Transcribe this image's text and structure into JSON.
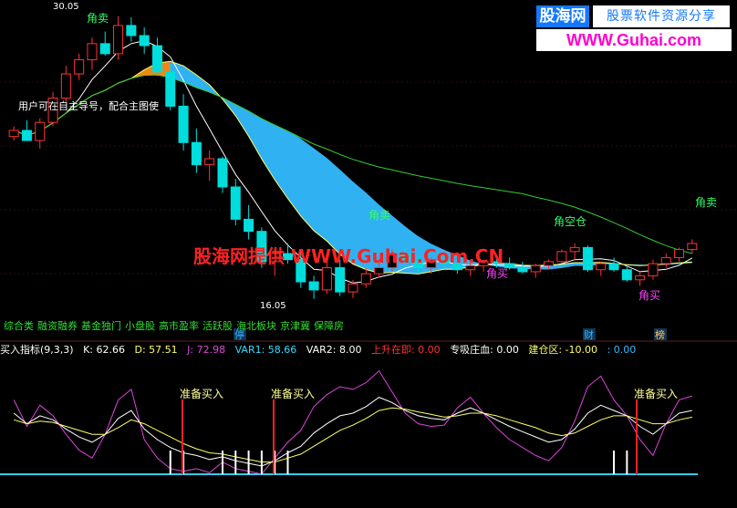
{
  "watermark": {
    "logo_text": "股海网",
    "tagline": "股票软件资源分享",
    "url": "WWW.Guhai.com",
    "center_text": "股海网提供 WWW.Guhai.Com.CN"
  },
  "tag_row": [
    "综合类",
    "融资融券",
    "基金独门",
    "小盘股",
    "高市盈率",
    "活跃股",
    "海北板块",
    "京津冀",
    "保障房"
  ],
  "indicator_header": {
    "name": "买入指标(9,3,3)",
    "k": "K: 62.66",
    "d": "D: 57.51",
    "j": "J: 72.98",
    "var1": "VAR1: 58.66",
    "var2": "VAR2: 8.00",
    "rise": "上升在即: 0.00",
    "zhuang": "专吸庄血: 0.00",
    "jiancang": "建仓区: -10.00",
    "tail": ": 0.00"
  },
  "colors": {
    "background": "#000000",
    "candle_up": "#ff3333",
    "candle_down": "#00dddd",
    "ribbon_orange": "#ff8c1a",
    "ribbon_blue": "#33bbff",
    "k_line": "#ffffff",
    "d_line": "#ffff66",
    "j_line": "#dd44dd",
    "baseline": "#33ccff",
    "signal": "#ff2222"
  },
  "chart_data": {
    "type": "candlestick",
    "price_high_label": "30.05",
    "price_low_label": "16.05",
    "annotations": {
      "sell_label": "角卖",
      "buy_label": "角买",
      "rise_label": "角空仓",
      "prepare_buy": "准备买入",
      "stop": "停",
      "finance": "财",
      "bank": "榜",
      "mid_text": "用户可在自主导号，配合主图使"
    },
    "candles": [
      [
        24.1,
        24.6,
        23.9,
        24.4
      ],
      [
        24.4,
        24.9,
        24.0,
        23.9
      ],
      [
        23.9,
        25.0,
        23.5,
        24.8
      ],
      [
        24.8,
        26.3,
        24.6,
        26.0
      ],
      [
        26.0,
        27.6,
        25.8,
        27.2
      ],
      [
        27.2,
        28.2,
        26.9,
        27.9
      ],
      [
        27.9,
        29.0,
        27.4,
        28.7
      ],
      [
        28.7,
        29.3,
        28.1,
        28.2
      ],
      [
        28.2,
        30.05,
        27.9,
        29.6
      ],
      [
        29.6,
        30.0,
        28.8,
        29.1
      ],
      [
        29.1,
        29.5,
        28.2,
        28.6
      ],
      [
        28.6,
        29.0,
        27.1,
        27.3
      ],
      [
        27.3,
        27.7,
        25.4,
        25.6
      ],
      [
        25.6,
        26.2,
        23.4,
        23.8
      ],
      [
        23.8,
        24.5,
        22.3,
        22.7
      ],
      [
        22.7,
        23.4,
        21.9,
        23.0
      ],
      [
        23.0,
        23.1,
        21.3,
        21.6
      ],
      [
        21.6,
        22.0,
        19.7,
        20.0
      ],
      [
        20.0,
        20.7,
        19.0,
        19.4
      ],
      [
        19.4,
        19.6,
        17.6,
        17.9
      ],
      [
        17.9,
        18.5,
        17.2,
        18.3
      ],
      [
        18.3,
        18.8,
        17.8,
        18.0
      ],
      [
        18.0,
        18.4,
        16.6,
        16.9
      ],
      [
        16.9,
        17.2,
        16.05,
        16.5
      ],
      [
        16.5,
        17.9,
        16.3,
        17.6
      ],
      [
        17.6,
        18.0,
        16.2,
        16.4
      ],
      [
        16.4,
        17.0,
        16.1,
        16.8
      ],
      [
        16.8,
        17.6,
        16.6,
        17.3
      ],
      [
        17.3,
        18.0,
        17.1,
        17.6
      ],
      [
        17.6,
        18.5,
        17.4,
        18.3
      ],
      [
        18.3,
        18.6,
        17.8,
        17.9
      ],
      [
        17.9,
        18.2,
        17.4,
        17.6
      ],
      [
        17.6,
        18.1,
        17.3,
        18.0
      ],
      [
        18.0,
        18.3,
        17.6,
        17.8
      ],
      [
        17.8,
        18.0,
        17.3,
        17.5
      ],
      [
        17.5,
        17.9,
        17.2,
        17.7
      ],
      [
        17.7,
        18.0,
        17.4,
        17.9
      ],
      [
        17.9,
        18.2,
        17.6,
        17.8
      ],
      [
        17.8,
        18.1,
        17.5,
        17.6
      ],
      [
        17.6,
        17.9,
        17.3,
        17.4
      ],
      [
        17.4,
        17.8,
        17.1,
        17.7
      ],
      [
        17.7,
        18.0,
        17.5,
        17.9
      ],
      [
        17.9,
        18.5,
        17.8,
        18.4
      ],
      [
        18.4,
        18.8,
        18.0,
        18.6
      ],
      [
        18.6,
        18.7,
        17.4,
        17.5
      ],
      [
        17.5,
        17.9,
        17.2,
        17.8
      ],
      [
        17.8,
        18.1,
        17.4,
        17.5
      ],
      [
        17.5,
        17.7,
        16.9,
        17.0
      ],
      [
        17.0,
        17.4,
        16.7,
        17.2
      ],
      [
        17.2,
        18.0,
        17.0,
        17.8
      ],
      [
        17.8,
        18.3,
        17.6,
        18.1
      ],
      [
        18.1,
        18.6,
        17.9,
        18.5
      ],
      [
        18.5,
        19.0,
        18.3,
        18.8
      ]
    ],
    "k_values": [
      60,
      52,
      58,
      55,
      48,
      42,
      38,
      44,
      56,
      62,
      48,
      40,
      34,
      30,
      28,
      25,
      27,
      24,
      22,
      20,
      24,
      30,
      35,
      45,
      52,
      58,
      60,
      65,
      72,
      68,
      62,
      58,
      56,
      55,
      60,
      64,
      60,
      55,
      50,
      46,
      42,
      38,
      40,
      48,
      60,
      66,
      62,
      58,
      50,
      44,
      52,
      60,
      62
    ],
    "d_values": [
      55,
      52,
      54,
      53,
      50,
      47,
      44,
      44,
      49,
      55,
      52,
      47,
      42,
      37,
      33,
      30,
      29,
      27,
      25,
      23,
      23,
      26,
      29,
      35,
      41,
      47,
      51,
      56,
      62,
      64,
      63,
      61,
      59,
      57,
      58,
      60,
      60,
      58,
      55,
      52,
      49,
      45,
      43,
      45,
      50,
      55,
      58,
      58,
      55,
      52,
      52,
      55,
      57
    ],
    "j_values": [
      70,
      50,
      66,
      58,
      44,
      32,
      26,
      44,
      70,
      78,
      40,
      26,
      18,
      16,
      18,
      15,
      23,
      18,
      16,
      14,
      26,
      38,
      47,
      65,
      74,
      80,
      78,
      83,
      92,
      76,
      60,
      52,
      50,
      51,
      64,
      72,
      60,
      49,
      40,
      34,
      28,
      24,
      34,
      54,
      80,
      88,
      70,
      58,
      40,
      28,
      52,
      70,
      73
    ]
  }
}
